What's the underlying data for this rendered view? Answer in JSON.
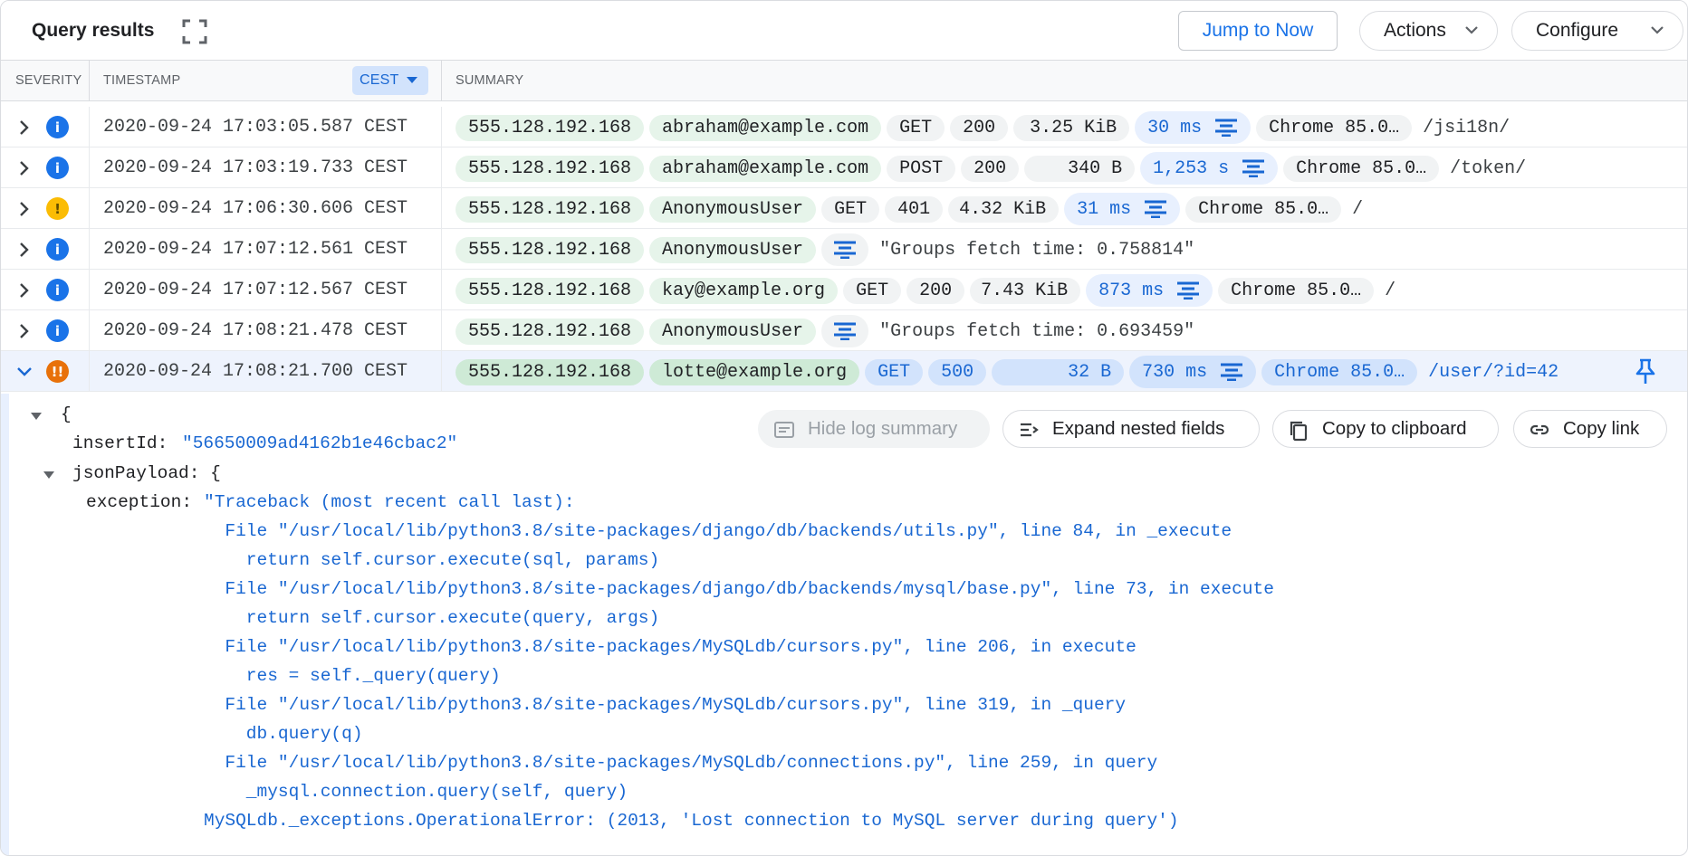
{
  "header": {
    "title": "Query results",
    "jump_label": "Jump to Now",
    "actions_label": "Actions",
    "configure_label": "Configure"
  },
  "columns": {
    "severity": "SEVERITY",
    "timestamp": "TIMESTAMP",
    "timezone": "CEST",
    "summary": "SUMMARY"
  },
  "colors": {
    "accent": "#1a73e8",
    "info": "#1a73e8",
    "warning": "#fbbc04",
    "error": "#e8710a"
  },
  "rows": [
    {
      "severity": "info",
      "icon": "info-icon",
      "timestamp": "2020-09-24 17:03:05.587 CEST",
      "ip": "555.128.192.168",
      "user": "abraham@example.com",
      "method": "GET",
      "status": "200",
      "size": "3.25 KiB",
      "latency": "30 ms",
      "agent": "Chrome 85.0…",
      "path": "/jsi18n/"
    },
    {
      "severity": "info",
      "icon": "info-icon",
      "timestamp": "2020-09-24 17:03:19.733 CEST",
      "ip": "555.128.192.168",
      "user": "abraham@example.com",
      "method": "POST",
      "status": "200",
      "size": "340 B",
      "latency": "1,253 s",
      "agent": "Chrome 85.0…",
      "path": "/token/"
    },
    {
      "severity": "warning",
      "icon": "warning-icon",
      "timestamp": "2020-09-24 17:06:30.606 CEST",
      "ip": "555.128.192.168",
      "user": "AnonymousUser",
      "method": "GET",
      "status": "401",
      "size": "4.32 KiB",
      "latency": "31 ms",
      "agent": "Chrome 85.0…",
      "path": "/"
    },
    {
      "severity": "info",
      "icon": "info-icon",
      "timestamp": "2020-09-24 17:07:12.561 CEST",
      "ip": "555.128.192.168",
      "user": "AnonymousUser",
      "message": "\"Groups fetch time: 0.758814\""
    },
    {
      "severity": "info",
      "icon": "info-icon",
      "timestamp": "2020-09-24 17:07:12.567 CEST",
      "ip": "555.128.192.168",
      "user": "kay@example.org",
      "method": "GET",
      "status": "200",
      "size": "7.43 KiB",
      "latency": "873 ms",
      "agent": "Chrome 85.0…",
      "path": "/"
    },
    {
      "severity": "info",
      "icon": "info-icon",
      "timestamp": "2020-09-24 17:08:21.478 CEST",
      "ip": "555.128.192.168",
      "user": "AnonymousUser",
      "message": "\"Groups fetch time: 0.693459\""
    },
    {
      "severity": "error",
      "icon": "error-icon",
      "timestamp": "2020-09-24 17:08:21.700 CEST",
      "ip": "555.128.192.168",
      "user": "lotte@example.org",
      "method": "GET",
      "status": "500",
      "size": "32 B",
      "latency": "730 ms",
      "agent": "Chrome 85.0…",
      "path": "/user/?id=42"
    }
  ],
  "detail": {
    "open_brace": "{",
    "insert_key": "insertId:",
    "insert_val": "\"56650009ad4162b1e46cbac2\"",
    "json_key": "jsonPayload: {",
    "exception_key": "exception:",
    "exception_lines": [
      "\"Traceback (most recent call last):",
      "  File \"/usr/local/lib/python3.8/site-packages/django/db/backends/utils.py\", line 84, in _execute",
      "    return self.cursor.execute(sql, params)",
      "  File \"/usr/local/lib/python3.8/site-packages/django/db/backends/mysql/base.py\", line 73, in execute",
      "    return self.cursor.execute(query, args)",
      "  File \"/usr/local/lib/python3.8/site-packages/MySQLdb/cursors.py\", line 206, in execute",
      "    res = self._query(query)",
      "  File \"/usr/local/lib/python3.8/site-packages/MySQLdb/cursors.py\", line 319, in _query",
      "    db.query(q)",
      "  File \"/usr/local/lib/python3.8/site-packages/MySQLdb/connections.py\", line 259, in query",
      "    _mysql.connection.query(self, query)",
      "MySQLdb._exceptions.OperationalError: (2013, 'Lost connection to MySQL server during query')"
    ],
    "actions": {
      "hide_summary": "Hide log summary",
      "expand_nested": "Expand nested fields",
      "copy_clipboard": "Copy to clipboard",
      "copy_link": "Copy link"
    }
  }
}
